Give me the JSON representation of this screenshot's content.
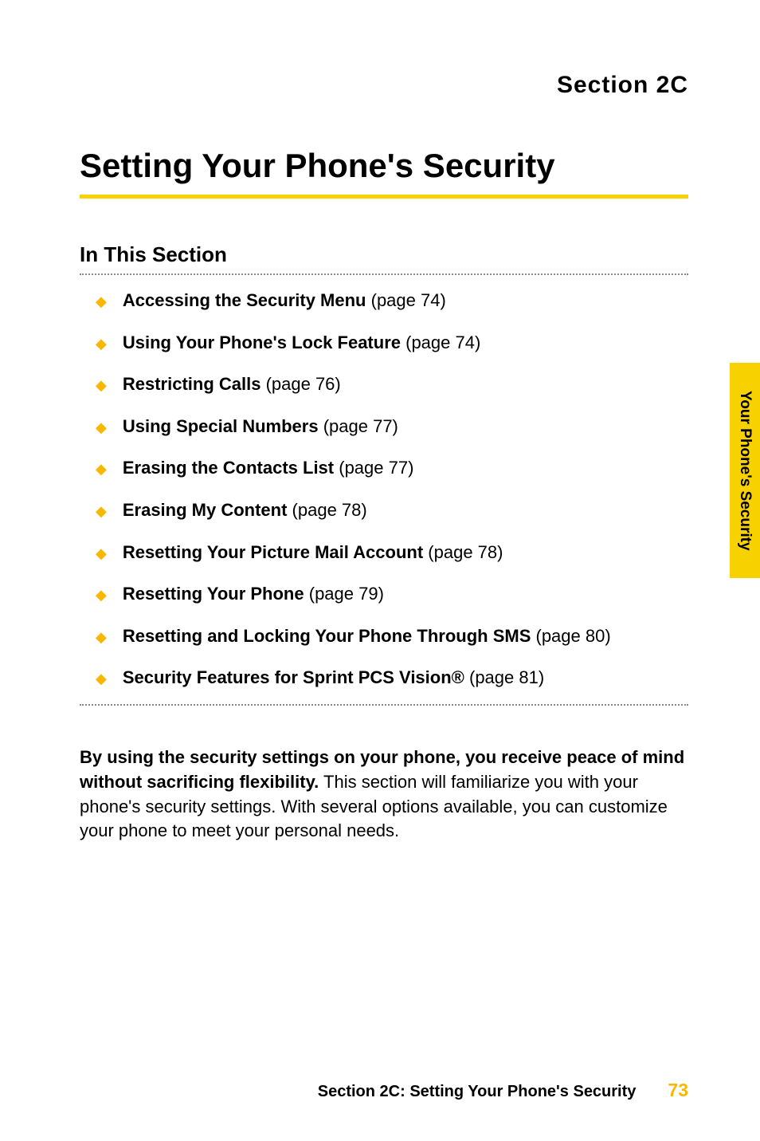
{
  "section_label": "Section 2C",
  "main_title": "Setting Your Phone's Security",
  "subsection_title": "In This Section",
  "toc": [
    {
      "bold": "Accessing the Security Menu",
      "page": " (page 74)"
    },
    {
      "bold": "Using Your Phone's Lock Feature",
      "page": " (page 74)"
    },
    {
      "bold": "Restricting Calls",
      "page": " (page 76)"
    },
    {
      "bold": "Using Special Numbers",
      "page": " (page 77)"
    },
    {
      "bold": "Erasing the Contacts List",
      "page": " (page 77)"
    },
    {
      "bold": "Erasing My Content",
      "page": " (page 78)"
    },
    {
      "bold": "Resetting Your Picture Mail Account",
      "page": " (page 78)"
    },
    {
      "bold": "Resetting Your Phone",
      "page": " (page 79)"
    },
    {
      "bold": "Resetting and Locking Your Phone Through SMS",
      "page": " (page 80)"
    },
    {
      "bold": "Security Features for Sprint PCS Vision®",
      "page": " (page 81)"
    }
  ],
  "body": {
    "bold_part": "By using the security settings on your phone, you receive peace of mind without sacrificing flexibility.",
    "regular_part": " This section will familiarize you with your phone's security settings. With several options available, you can customize your phone to meet your personal needs."
  },
  "side_tab": "Your Phone's Security",
  "footer": {
    "text": "Section 2C: Setting Your Phone's Security",
    "page": "73"
  },
  "bullet_char": "◆"
}
